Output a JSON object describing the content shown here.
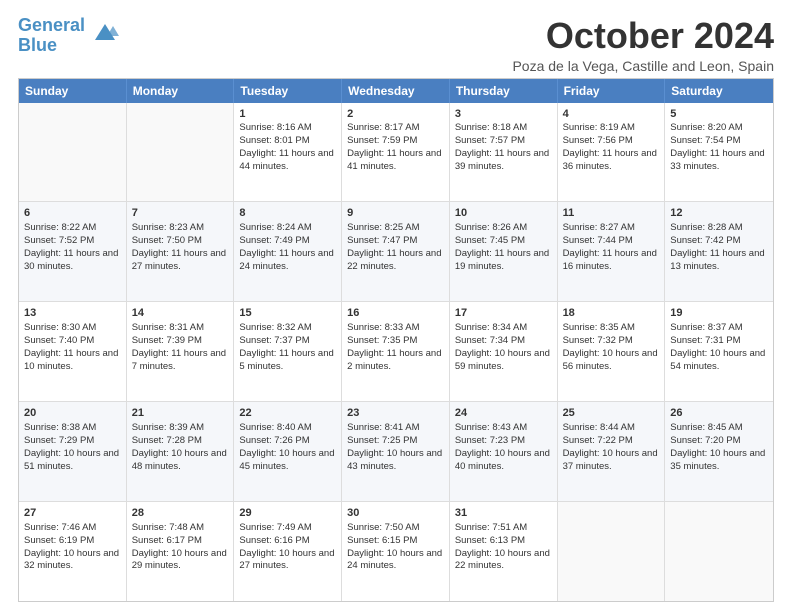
{
  "logo": {
    "line1": "General",
    "line2": "Blue"
  },
  "title": "October 2024",
  "location": "Poza de la Vega, Castille and Leon, Spain",
  "days_of_week": [
    "Sunday",
    "Monday",
    "Tuesday",
    "Wednesday",
    "Thursday",
    "Friday",
    "Saturday"
  ],
  "weeks": [
    [
      {
        "day": "",
        "info": ""
      },
      {
        "day": "",
        "info": ""
      },
      {
        "day": "1",
        "info": "Sunrise: 8:16 AM\nSunset: 8:01 PM\nDaylight: 11 hours and 44 minutes."
      },
      {
        "day": "2",
        "info": "Sunrise: 8:17 AM\nSunset: 7:59 PM\nDaylight: 11 hours and 41 minutes."
      },
      {
        "day": "3",
        "info": "Sunrise: 8:18 AM\nSunset: 7:57 PM\nDaylight: 11 hours and 39 minutes."
      },
      {
        "day": "4",
        "info": "Sunrise: 8:19 AM\nSunset: 7:56 PM\nDaylight: 11 hours and 36 minutes."
      },
      {
        "day": "5",
        "info": "Sunrise: 8:20 AM\nSunset: 7:54 PM\nDaylight: 11 hours and 33 minutes."
      }
    ],
    [
      {
        "day": "6",
        "info": "Sunrise: 8:22 AM\nSunset: 7:52 PM\nDaylight: 11 hours and 30 minutes."
      },
      {
        "day": "7",
        "info": "Sunrise: 8:23 AM\nSunset: 7:50 PM\nDaylight: 11 hours and 27 minutes."
      },
      {
        "day": "8",
        "info": "Sunrise: 8:24 AM\nSunset: 7:49 PM\nDaylight: 11 hours and 24 minutes."
      },
      {
        "day": "9",
        "info": "Sunrise: 8:25 AM\nSunset: 7:47 PM\nDaylight: 11 hours and 22 minutes."
      },
      {
        "day": "10",
        "info": "Sunrise: 8:26 AM\nSunset: 7:45 PM\nDaylight: 11 hours and 19 minutes."
      },
      {
        "day": "11",
        "info": "Sunrise: 8:27 AM\nSunset: 7:44 PM\nDaylight: 11 hours and 16 minutes."
      },
      {
        "day": "12",
        "info": "Sunrise: 8:28 AM\nSunset: 7:42 PM\nDaylight: 11 hours and 13 minutes."
      }
    ],
    [
      {
        "day": "13",
        "info": "Sunrise: 8:30 AM\nSunset: 7:40 PM\nDaylight: 11 hours and 10 minutes."
      },
      {
        "day": "14",
        "info": "Sunrise: 8:31 AM\nSunset: 7:39 PM\nDaylight: 11 hours and 7 minutes."
      },
      {
        "day": "15",
        "info": "Sunrise: 8:32 AM\nSunset: 7:37 PM\nDaylight: 11 hours and 5 minutes."
      },
      {
        "day": "16",
        "info": "Sunrise: 8:33 AM\nSunset: 7:35 PM\nDaylight: 11 hours and 2 minutes."
      },
      {
        "day": "17",
        "info": "Sunrise: 8:34 AM\nSunset: 7:34 PM\nDaylight: 10 hours and 59 minutes."
      },
      {
        "day": "18",
        "info": "Sunrise: 8:35 AM\nSunset: 7:32 PM\nDaylight: 10 hours and 56 minutes."
      },
      {
        "day": "19",
        "info": "Sunrise: 8:37 AM\nSunset: 7:31 PM\nDaylight: 10 hours and 54 minutes."
      }
    ],
    [
      {
        "day": "20",
        "info": "Sunrise: 8:38 AM\nSunset: 7:29 PM\nDaylight: 10 hours and 51 minutes."
      },
      {
        "day": "21",
        "info": "Sunrise: 8:39 AM\nSunset: 7:28 PM\nDaylight: 10 hours and 48 minutes."
      },
      {
        "day": "22",
        "info": "Sunrise: 8:40 AM\nSunset: 7:26 PM\nDaylight: 10 hours and 45 minutes."
      },
      {
        "day": "23",
        "info": "Sunrise: 8:41 AM\nSunset: 7:25 PM\nDaylight: 10 hours and 43 minutes."
      },
      {
        "day": "24",
        "info": "Sunrise: 8:43 AM\nSunset: 7:23 PM\nDaylight: 10 hours and 40 minutes."
      },
      {
        "day": "25",
        "info": "Sunrise: 8:44 AM\nSunset: 7:22 PM\nDaylight: 10 hours and 37 minutes."
      },
      {
        "day": "26",
        "info": "Sunrise: 8:45 AM\nSunset: 7:20 PM\nDaylight: 10 hours and 35 minutes."
      }
    ],
    [
      {
        "day": "27",
        "info": "Sunrise: 7:46 AM\nSunset: 6:19 PM\nDaylight: 10 hours and 32 minutes."
      },
      {
        "day": "28",
        "info": "Sunrise: 7:48 AM\nSunset: 6:17 PM\nDaylight: 10 hours and 29 minutes."
      },
      {
        "day": "29",
        "info": "Sunrise: 7:49 AM\nSunset: 6:16 PM\nDaylight: 10 hours and 27 minutes."
      },
      {
        "day": "30",
        "info": "Sunrise: 7:50 AM\nSunset: 6:15 PM\nDaylight: 10 hours and 24 minutes."
      },
      {
        "day": "31",
        "info": "Sunrise: 7:51 AM\nSunset: 6:13 PM\nDaylight: 10 hours and 22 minutes."
      },
      {
        "day": "",
        "info": ""
      },
      {
        "day": "",
        "info": ""
      }
    ]
  ]
}
